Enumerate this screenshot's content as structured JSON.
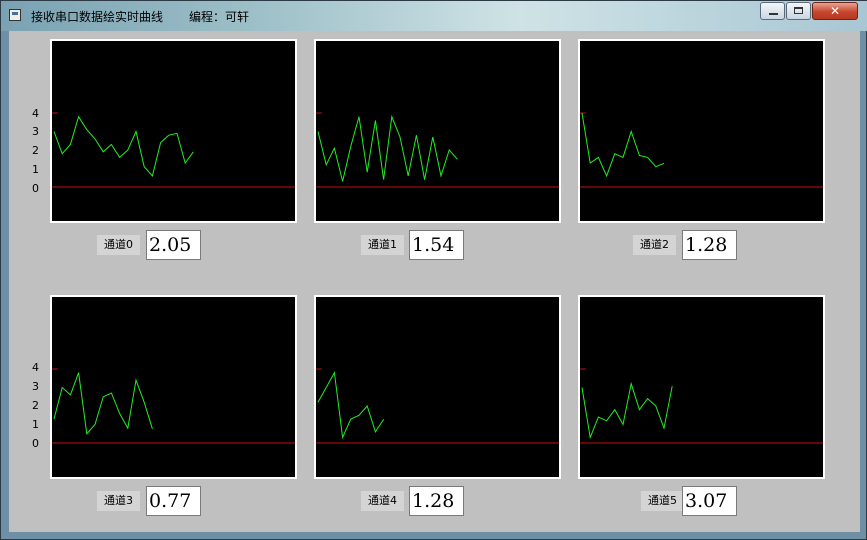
{
  "window": {
    "title": "接收串口数据绘实时曲线",
    "author": "编程：可轩",
    "controls": {
      "minimize": "minimize",
      "maximize": "maximize",
      "close": "✕"
    }
  },
  "y_axis_labels": [
    "4",
    "3",
    "2",
    "1",
    "0"
  ],
  "colors": {
    "trace": "#22ee22",
    "baseline": "#c01010",
    "plot_bg": "#000000",
    "client_bg": "#c0c0c0"
  },
  "channels": [
    {
      "label": "通道0",
      "value": "2.05",
      "samples": [
        3.0,
        1.8,
        2.3,
        3.8,
        3.1,
        2.6,
        1.9,
        2.3,
        1.6,
        2.0,
        3.0,
        1.1,
        0.6,
        2.4,
        2.8,
        2.9,
        1.3,
        1.9
      ]
    },
    {
      "label": "通道1",
      "value": "1.54",
      "samples": [
        3.0,
        1.2,
        2.1,
        0.3,
        2.2,
        3.8,
        0.8,
        3.6,
        0.4,
        3.8,
        2.7,
        0.6,
        2.8,
        0.4,
        2.7,
        0.6,
        2.0,
        1.5
      ]
    },
    {
      "label": "通道2",
      "value": "1.28",
      "samples": [
        4.0,
        1.3,
        1.6,
        0.6,
        1.8,
        1.6,
        3.0,
        1.7,
        1.6,
        1.1,
        1.28
      ]
    },
    {
      "label": "通道3",
      "value": "0.77",
      "samples": [
        1.3,
        3.0,
        2.6,
        3.8,
        0.5,
        1.0,
        2.5,
        2.7,
        1.6,
        0.8,
        3.4,
        2.2,
        0.77
      ]
    },
    {
      "label": "通道4",
      "value": "1.28",
      "samples": [
        2.2,
        3.0,
        3.8,
        0.3,
        1.3,
        1.5,
        2.0,
        0.6,
        1.28
      ]
    },
    {
      "label": "通道5",
      "value": "3.07",
      "samples": [
        3.0,
        0.3,
        1.4,
        1.2,
        1.8,
        1.0,
        3.2,
        1.8,
        2.4,
        2.0,
        0.8,
        3.07
      ]
    }
  ]
}
